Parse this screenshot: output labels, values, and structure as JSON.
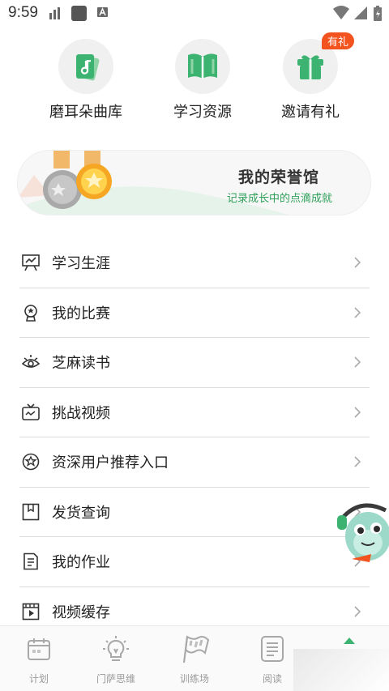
{
  "status_bar": {
    "time": "9:59"
  },
  "quick_actions": [
    {
      "label": "磨耳朵曲库",
      "icon": "music-cards-icon"
    },
    {
      "label": "学习资源",
      "icon": "open-book-icon"
    },
    {
      "label": "邀请有礼",
      "icon": "gift-box-icon",
      "badge": "有礼"
    }
  ],
  "banner": {
    "title": "我的荣誉馆",
    "subtitle": "记录成长中的点滴成就"
  },
  "menu": [
    {
      "label": "学习生涯",
      "icon": "presentation-board-icon"
    },
    {
      "label": "我的比赛",
      "icon": "trophy-icon"
    },
    {
      "label": "芝麻读书",
      "icon": "reading-eye-icon"
    },
    {
      "label": "挑战视频",
      "icon": "tv-icon"
    },
    {
      "label": "资深用户推荐入口",
      "icon": "star-circle-icon"
    },
    {
      "label": "发货查询",
      "icon": "package-icon"
    },
    {
      "label": "我的作业",
      "icon": "document-icon"
    },
    {
      "label": "视频缓存",
      "icon": "film-icon"
    }
  ],
  "bottom_nav": [
    {
      "label": "计划",
      "icon": "calendar-icon"
    },
    {
      "label": "门萨思维",
      "icon": "lightbulb-icon"
    },
    {
      "label": "训练场",
      "icon": "flag-icon"
    },
    {
      "label": "阅读",
      "icon": "book-icon"
    }
  ],
  "colors": {
    "accent_green": "#3cb371",
    "badge_orange": "#f2531f",
    "subtitle_green": "#2fa05a"
  }
}
